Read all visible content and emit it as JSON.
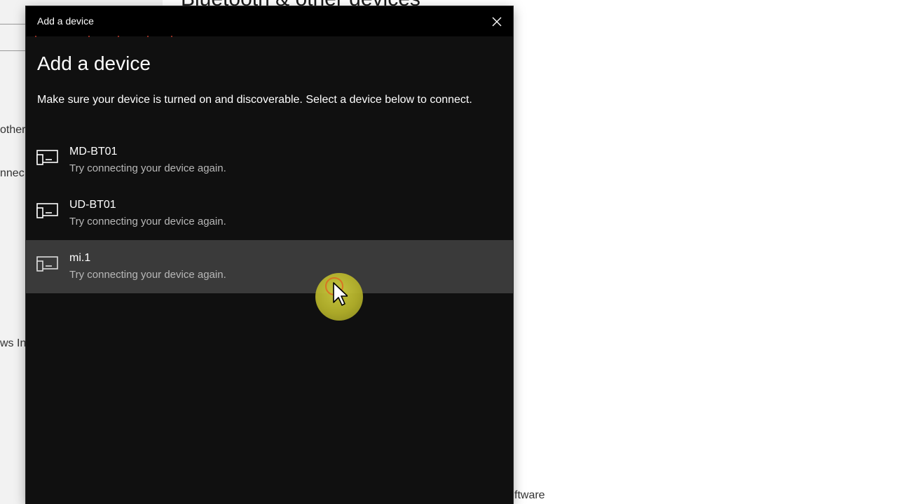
{
  "background": {
    "heading": "Bluetooth & other devices",
    "snippets": [
      "other",
      "nnec",
      "ws In",
      "ftware"
    ]
  },
  "dialog": {
    "title": "Add a device",
    "heading": "Add a device",
    "instructions": "Make sure your device is turned on and discoverable. Select a device below to connect.",
    "devices": [
      {
        "name": "MD-BT01",
        "status": "Try connecting your device again.",
        "icon": "device-generic-icon"
      },
      {
        "name": "UD-BT01",
        "status": "Try connecting your device again.",
        "icon": "device-generic-icon"
      },
      {
        "name": "mi.1",
        "status": "Try connecting your device again.",
        "icon": "device-generic-icon"
      }
    ]
  },
  "colors": {
    "dialog_bg": "#101010",
    "titlebar_bg": "#000000",
    "hover_bg": "#3a3a3a",
    "secondary_text": "#b8b8b8",
    "cursor_highlight": "#c8c42e"
  }
}
